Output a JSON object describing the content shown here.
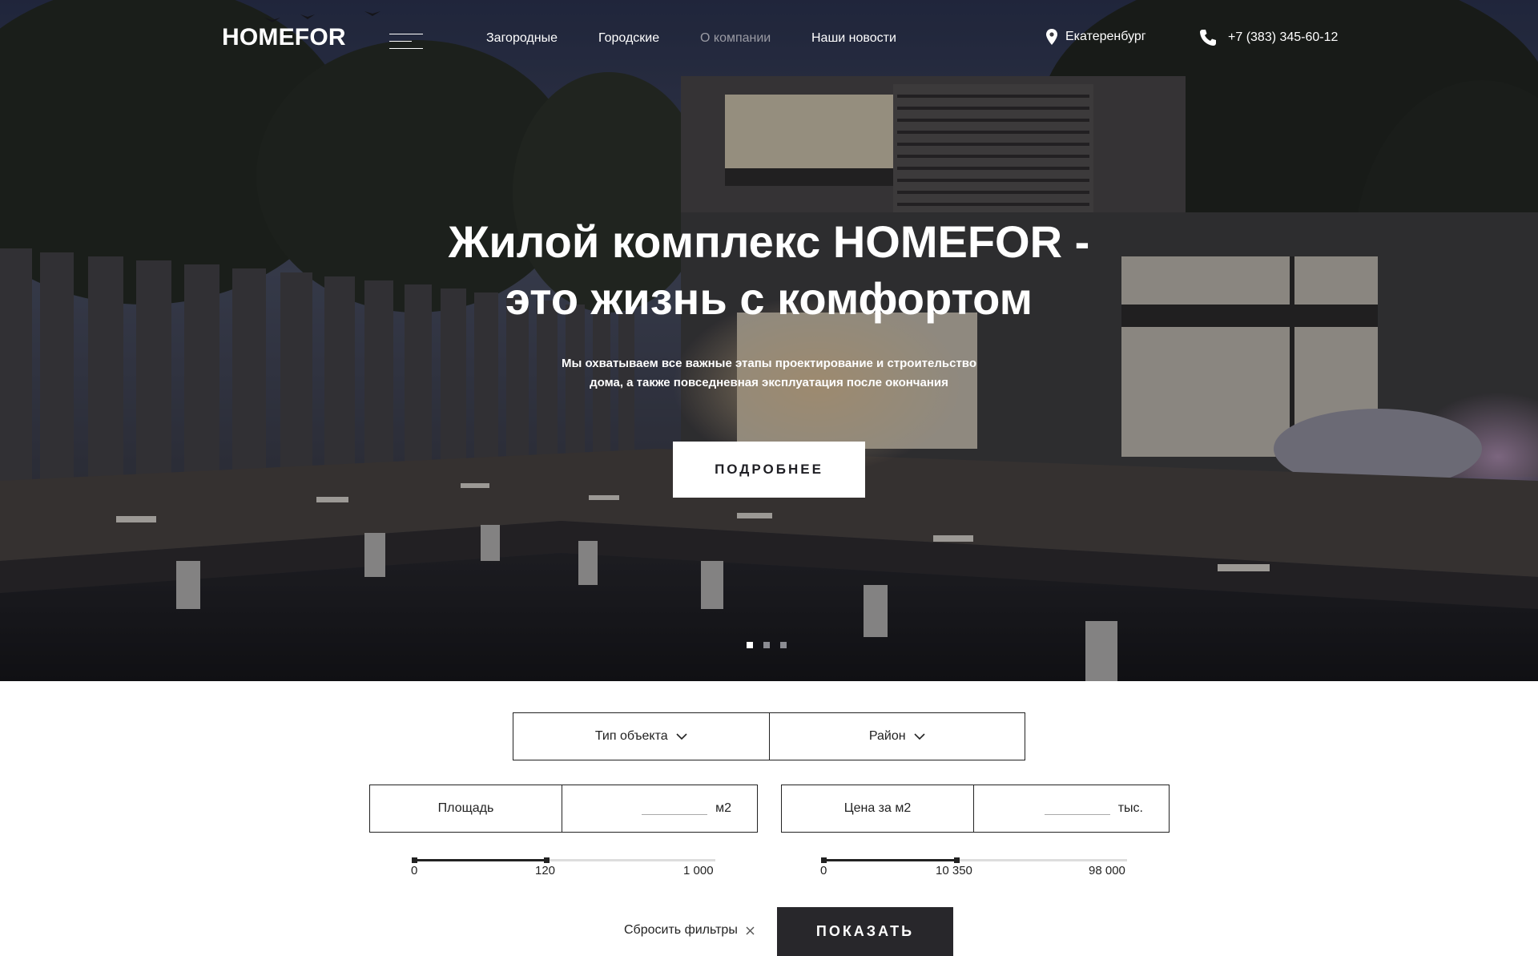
{
  "header": {
    "logo": "HOMEFOR",
    "nav": [
      {
        "label": "Загородные"
      },
      {
        "label": "Городские"
      },
      {
        "label": "О компании"
      },
      {
        "label": "Наши новости"
      }
    ],
    "city": "Екатеренбург",
    "phone": "+7 (383) 345-60-12"
  },
  "hero": {
    "title_line1": "Жилой комплекс HOMEFOR  -",
    "title_line2": "это жизнь с комфортом",
    "subtitle_line1": "Мы охватываем все важные этапы проектирование и строительство",
    "subtitle_line2": "дома, а также повседневная эксплуатация после окончания",
    "button": "ПОДРОБНЕЕ",
    "slides": 3,
    "active_slide": 0
  },
  "filters": {
    "object_type": "Тип объекта",
    "district": "Район",
    "area": {
      "label": "Площадь",
      "value": "",
      "unit": "м2",
      "min": "0",
      "current": "120",
      "max": "1 000",
      "current_fraction": 0.44
    },
    "price": {
      "label": "Цена за м2",
      "value": "",
      "unit": "тыс.",
      "min": "0",
      "current": "10 350",
      "max": "98 000",
      "current_fraction": 0.44
    },
    "reset": "Сбросить фильтры",
    "show": "ПОКАЗАТЬ"
  },
  "colors": {
    "dark_button": "#28272b",
    "muted_nav": "#9a9ba4"
  }
}
